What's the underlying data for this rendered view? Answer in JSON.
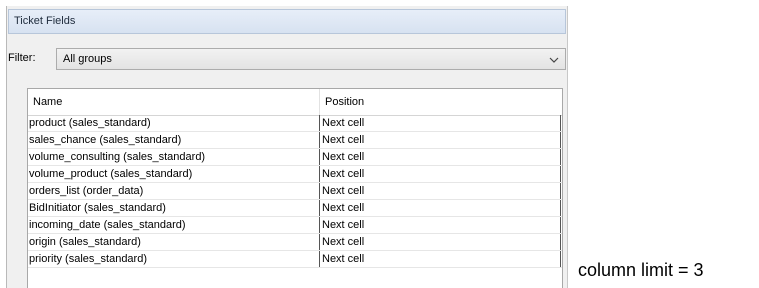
{
  "window": {
    "title": "Ticket Fields"
  },
  "filter": {
    "label": "Filter:",
    "selected": "All groups"
  },
  "table": {
    "columns": [
      "Name",
      "Position"
    ],
    "rows": [
      {
        "name": "product (sales_standard)",
        "position": "Next cell"
      },
      {
        "name": "sales_chance (sales_standard)",
        "position": "Next cell"
      },
      {
        "name": "volume_consulting (sales_standard)",
        "position": "Next cell"
      },
      {
        "name": "volume_product (sales_standard)",
        "position": "Next cell"
      },
      {
        "name": "orders_list (order_data)",
        "position": "Next cell"
      },
      {
        "name": "BidInitiator (sales_standard)",
        "position": "Next cell"
      },
      {
        "name": "incoming_date (sales_standard)",
        "position": "Next cell"
      },
      {
        "name": "origin (sales_standard)",
        "position": "Next cell"
      },
      {
        "name": "priority (sales_standard)",
        "position": "Next cell"
      }
    ]
  },
  "annotation": {
    "text": "column limit = 3"
  }
}
